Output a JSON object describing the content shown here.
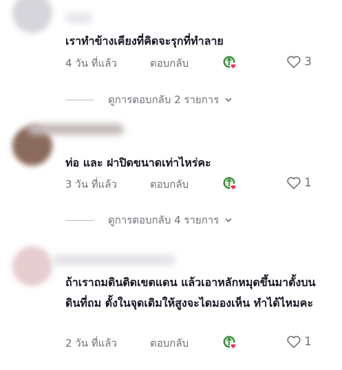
{
  "comments": [
    {
      "text": "เราทำข้างเคียงที่คิดจะรุกที่ทำลาย",
      "time": "4 วัน ที่แล้ว",
      "reply_label": "ตอบกลับ",
      "like_count": "3",
      "view_replies": "ดูการตอบกลับ 2 รายการ",
      "avatar_color": "#d5d6dc"
    },
    {
      "text": "ท่อ และ ฝาปิดขนาดเท่าไหร่คะ",
      "time": "3 วัน ที่แล้ว",
      "reply_label": "ตอบกลับ",
      "like_count": "1",
      "view_replies": "ดูการตอบกลับ 4 รายการ",
      "avatar_color": "#8a6a5c"
    },
    {
      "text": "ถ้าเราถมดินติดเขตแดน แล้วเอาหลักหมุดขึ้นมาตั้งบนดินที่ถม ตั้งในจุดเดิมให้สูงจะไดมองเห็น ทำได้ไหมคะ",
      "time": "2 วัน ที่แล้ว",
      "reply_label": "ตอบกลับ",
      "like_count": "1",
      "avatar_color": "#e6cdd0"
    }
  ],
  "colors": {
    "text": "#161823",
    "muted": "#6f7077",
    "creator_badge": "#3a8f3e",
    "heart_badge": "#fe2c55"
  },
  "icons": {
    "like": "heart-outline-icon",
    "creator": "creator-liked-icon",
    "expand": "chevron-down-icon"
  }
}
